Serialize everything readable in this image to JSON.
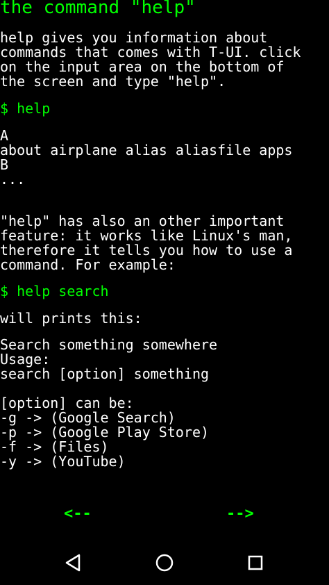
{
  "title": "the command \"help\"",
  "intro": "help gives you information about\ncommands that comes with T-UI. click\non the input area on the bottom of\nthe screen and type \"help\".",
  "command1": "$ help",
  "output1": "A\nabout airplane alias aliasfile apps\nB\n...",
  "explanation": "\"help\" has also an other important\nfeature: it works like Linux's man,\ntherefore it tells you how to use a\ncommand. For example:",
  "command2": "$ help search",
  "will_print": "will prints this:",
  "output2": "Search something somewhere\nUsage:\nsearch [option] something",
  "options": "[option] can be:\n-g -> (Google Search)\n-p -> (Google Play Store)\n-f -> (Files)\n-y -> (YouTube)",
  "nav": {
    "prev_label": "<--",
    "next_label": "-->"
  },
  "system_nav": {
    "back_icon": "triangle-back-icon",
    "home_icon": "circle-home-icon",
    "recents_icon": "square-recents-icon"
  },
  "colors": {
    "accent": "#00ff00",
    "text": "#ffffff",
    "background": "#000000"
  }
}
